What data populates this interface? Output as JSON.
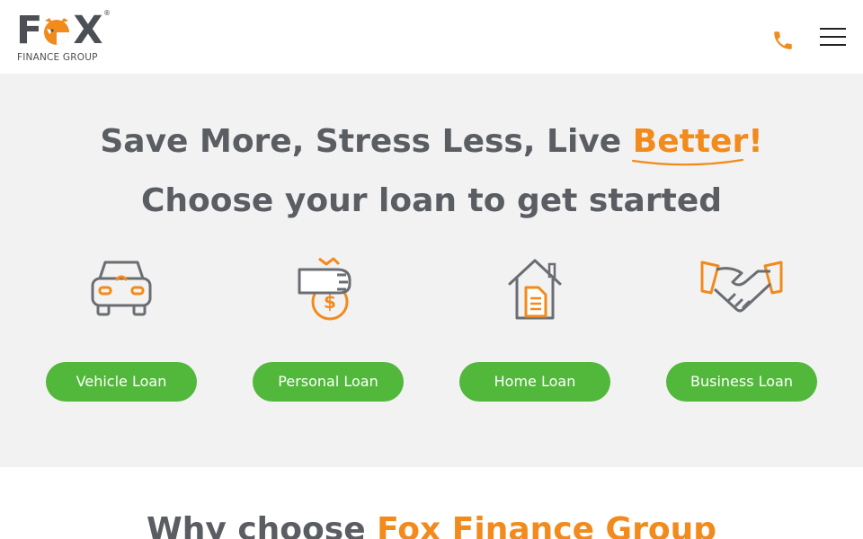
{
  "header": {
    "logo": {
      "word_left": "F",
      "word_right": "X",
      "registered": "®",
      "subtitle": "FINANCE GROUP"
    },
    "phone_icon": "phone-icon",
    "menu_icon": "hamburger-menu-icon"
  },
  "hero": {
    "headline_prefix": "Save More, Stress Less, Live ",
    "headline_accent": "Better!",
    "subheadline": "Choose your loan to get started",
    "loans": [
      {
        "icon": "car-icon",
        "label": "Vehicle Loan"
      },
      {
        "icon": "money-bag-hand-icon",
        "label": "Personal Loan"
      },
      {
        "icon": "house-document-icon",
        "label": "Home Loan"
      },
      {
        "icon": "handshake-icon",
        "label": "Business Loan"
      }
    ]
  },
  "why": {
    "title_prefix": "Why choose ",
    "title_accent": "Fox Finance Group"
  },
  "colors": {
    "accent_orange": "#f28a1c",
    "button_green": "#52b83b",
    "text_gray": "#5a5d62",
    "hero_bg": "#f2f2f2"
  }
}
